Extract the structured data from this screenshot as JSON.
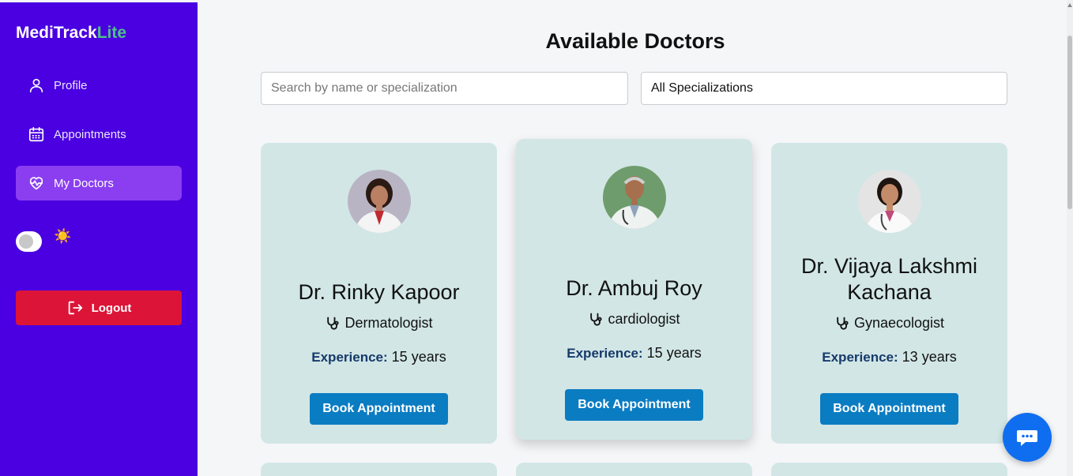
{
  "app": {
    "brand_main": "MediTrack",
    "brand_accent": "Lite"
  },
  "sidebar": {
    "items": [
      {
        "label": "Profile",
        "icon": "user-icon"
      },
      {
        "label": "Appointments",
        "icon": "calendar-icon"
      },
      {
        "label": "My Doctors",
        "icon": "heart-pulse-icon",
        "active": true
      }
    ],
    "theme_icon": "☀️",
    "logout_label": "Logout"
  },
  "main": {
    "title": "Available Doctors",
    "search": {
      "placeholder": "Search by name or specialization",
      "value": ""
    },
    "filter": {
      "selected": "All Specializations"
    }
  },
  "doctors": [
    {
      "name": "Dr. Rinky Kapoor",
      "specialization": "Dermatologist",
      "experience_label": "Experience:",
      "experience_value": "15 years",
      "button": "Book Appointment"
    },
    {
      "name": "Dr. Ambuj Roy",
      "specialization": "cardiologist",
      "experience_label": "Experience:",
      "experience_value": "15 years",
      "button": "Book Appointment"
    },
    {
      "name": "Dr. Vijaya Lakshmi Kachana",
      "specialization": "Gynaecologist",
      "experience_label": "Experience:",
      "experience_value": "13 years",
      "button": "Book Appointment"
    }
  ],
  "colors": {
    "sidebar": "#4a00e0",
    "active_item": "#8a3ef0",
    "logout": "#dc1437",
    "card": "#d2e6e6",
    "button": "#0a7cc2",
    "chat": "#0f6ef0",
    "brand_accent": "#4cc38a"
  }
}
